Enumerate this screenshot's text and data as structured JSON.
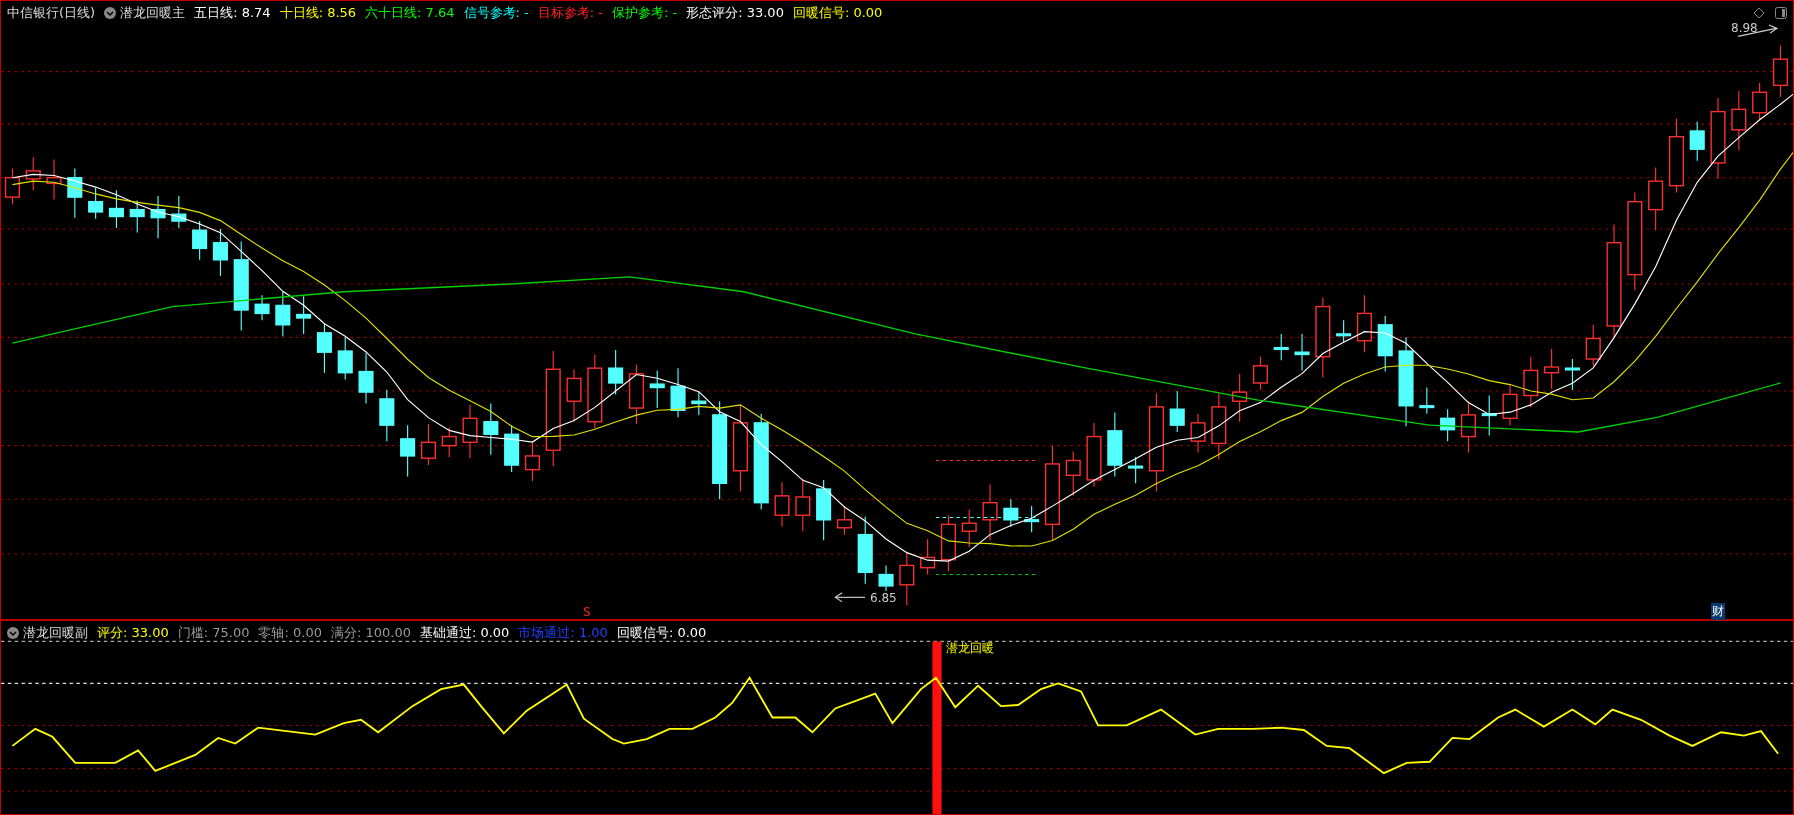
{
  "main_pane": {
    "stock_title": "中信银行(日线)",
    "indicator": "潜龙回暖主",
    "legend": [
      {
        "text": "五日线: 8.74",
        "color": "#ffffff"
      },
      {
        "text": "十日线: 8.56",
        "color": "#ffff00"
      },
      {
        "text": "六十日线: 7.64",
        "color": "#00ff00"
      },
      {
        "text": "信号参考: -",
        "color": "#00ffff"
      },
      {
        "text": "目标参考: -",
        "color": "#ff2020"
      },
      {
        "text": "保护参考: -",
        "color": "#00ff00"
      },
      {
        "text": "形态评分: 33.00",
        "color": "#ffffff"
      },
      {
        "text": "回暖信号: 0.00",
        "color": "#ffff00"
      }
    ],
    "high_label": "8.98",
    "low_label": "6.85",
    "s_marker": "S",
    "finance_marker": "财"
  },
  "sub_pane": {
    "indicator": "潜龙回暖副",
    "legend": [
      {
        "text": "评分: 33.00",
        "color": "#ffff00"
      },
      {
        "text": "门槛: 75.00",
        "color": "#9a9a9a"
      },
      {
        "text": "零轴: 0.00",
        "color": "#9a9a9a"
      },
      {
        "text": "满分: 100.00",
        "color": "#9a9a9a"
      },
      {
        "text": "基础通过: 0.00",
        "color": "#ffffff"
      },
      {
        "text": "市场通过: 1.00",
        "color": "#2040ff"
      },
      {
        "text": "回暖信号: 0.00",
        "color": "#ffffff"
      }
    ],
    "signal_label": "潜龙回暖"
  }
}
